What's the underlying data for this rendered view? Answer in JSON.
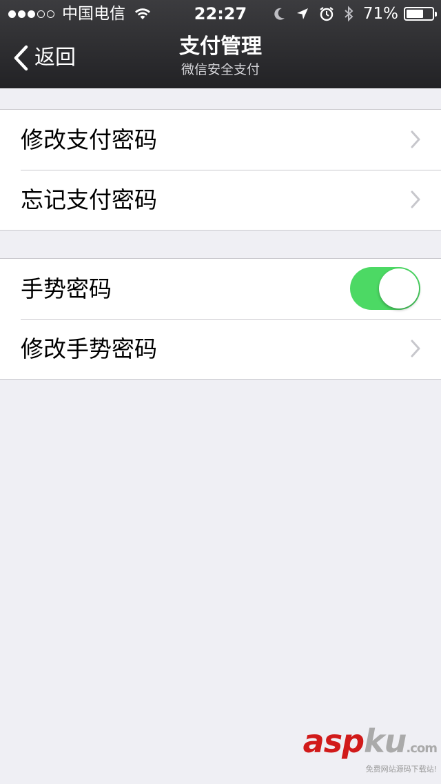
{
  "status_bar": {
    "signal": {
      "filled": 3,
      "total": 5
    },
    "carrier": "中国电信",
    "time": "22:27",
    "battery_percent_text": "71%",
    "battery_level": 0.71,
    "icons": [
      "wifi-icon",
      "moon-icon",
      "location-arrow-icon",
      "alarm-icon",
      "bluetooth-icon",
      "battery-icon"
    ]
  },
  "nav": {
    "back_label": "返回",
    "title": "支付管理",
    "subtitle": "微信安全支付"
  },
  "groups": [
    {
      "items": [
        {
          "label": "修改支付密码",
          "accessory": "chevron-right-icon"
        },
        {
          "label": "忘记支付密码",
          "accessory": "chevron-right-icon"
        }
      ]
    },
    {
      "items": [
        {
          "label": "手势密码",
          "accessory": "toggle",
          "toggle_on": true
        },
        {
          "label": "修改手势密码",
          "accessory": "chevron-right-icon"
        }
      ]
    }
  ],
  "colors": {
    "background": "#efeff4",
    "toggle_on": "#4cd964",
    "separator": "#c8c7cc",
    "chevron": "#c7c7cc",
    "header_bg": "#2e2e31"
  },
  "watermark": {
    "asp": "asp",
    "ku": "ku",
    "dotcom": ".com",
    "tagline": "免费网站源码下载站!"
  }
}
